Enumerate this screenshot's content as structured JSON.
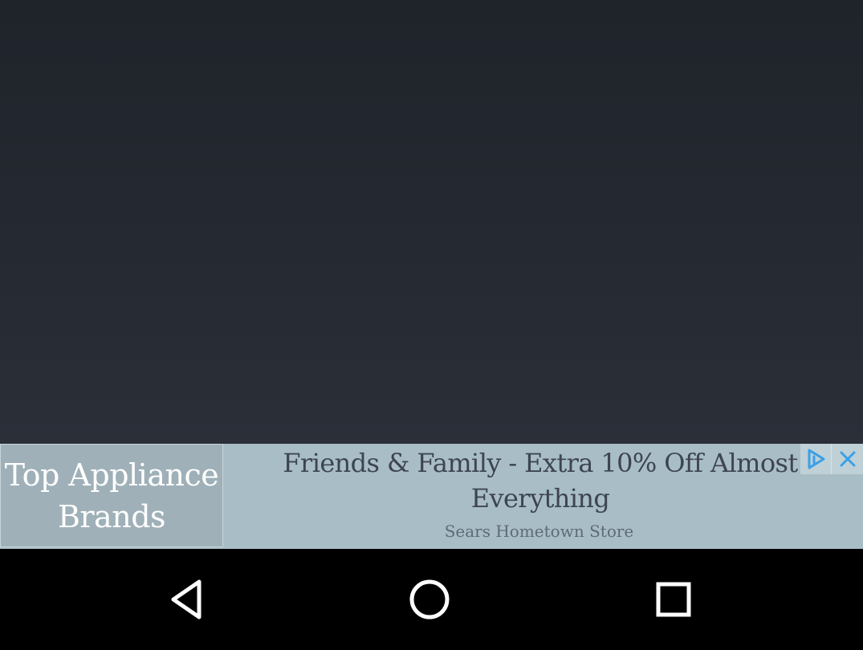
{
  "ad": {
    "left_text_line1": "Top Appliance",
    "left_text_line2": "Brands",
    "headline_line1": "Friends & Family - Extra 10% Off Almost",
    "headline_line2": "Everything",
    "advertiser": "Sears Hometown Store",
    "choices_icon": "adchoices-icon",
    "close_icon": "close-icon",
    "accent_color": "#3aa0e6"
  },
  "navbar": {
    "back_icon": "back-triangle-icon",
    "home_icon": "home-circle-icon",
    "recents_icon": "recents-square-icon"
  }
}
